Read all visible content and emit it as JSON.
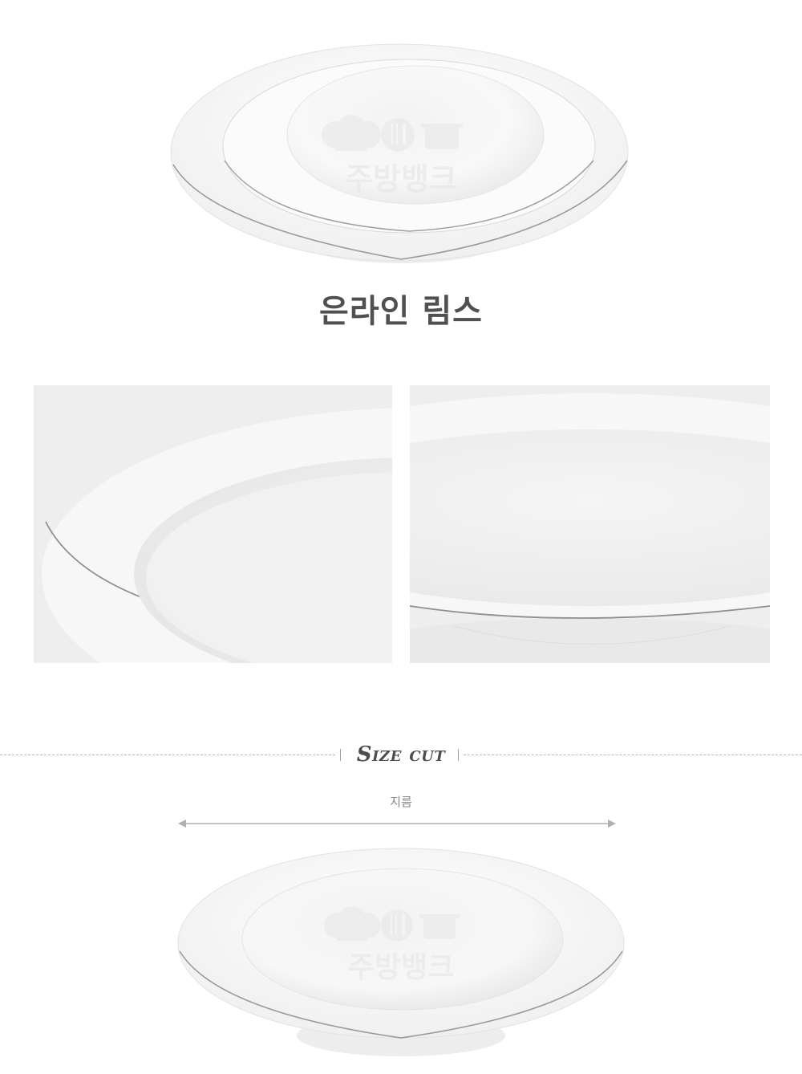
{
  "title": "은라인 림스",
  "watermark": {
    "text": "주방뱅크",
    "icons": [
      "chef-hat-icon",
      "fork-knife-icon",
      "cooking-pot-icon"
    ]
  },
  "size_section": {
    "heading": "Size cut",
    "dimension_label": "지름"
  },
  "colors": {
    "background": "#ffffff",
    "title": "#505050",
    "porcelain": "#f7f7f7",
    "silver_rim": "#9a9a9a",
    "detail_background": "#eeeeee",
    "dash": "#b8b8b8",
    "label": "#888888"
  }
}
